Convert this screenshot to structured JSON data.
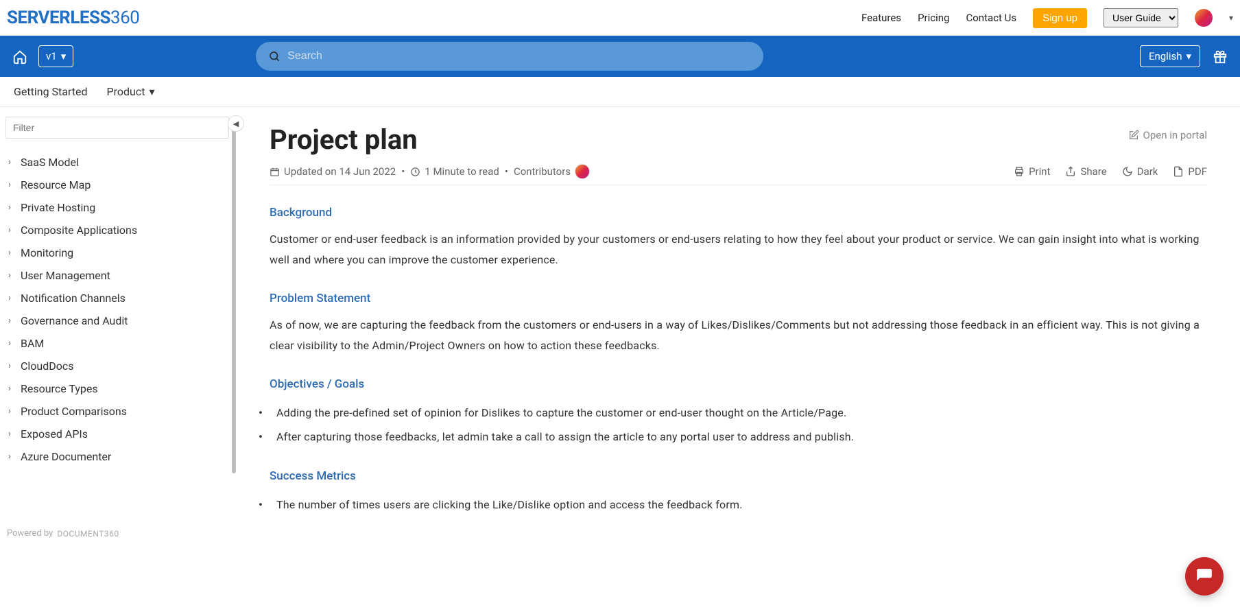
{
  "header": {
    "logo_prefix": "SERVERLESS",
    "logo_suffix": "360",
    "nav": {
      "features": "Features",
      "pricing": "Pricing",
      "contact": "Contact Us"
    },
    "signup": "Sign up",
    "user_guide": "User Guide"
  },
  "bluebar": {
    "version": "v1",
    "search_placeholder": "Search",
    "language": "English"
  },
  "subnav": {
    "getting_started": "Getting Started",
    "product": "Product"
  },
  "sidebar": {
    "filter_placeholder": "Filter",
    "items": [
      "SaaS Model",
      "Resource Map",
      "Private Hosting",
      "Composite Applications",
      "Monitoring",
      "User Management",
      "Notification Channels",
      "Governance and Audit",
      "BAM",
      "CloudDocs",
      "Resource Types",
      "Product Comparisons",
      "Exposed APIs",
      "Azure Documenter"
    ],
    "powered_by": "Powered by",
    "powered_brand": "DOCUMENT360"
  },
  "article": {
    "title": "Project plan",
    "open_in_portal": "Open in portal",
    "updated": "Updated on 14 Jun 2022",
    "read_time": "1 Minute to read",
    "contributors_label": "Contributors",
    "actions": {
      "print": "Print",
      "share": "Share",
      "dark": "Dark",
      "pdf": "PDF"
    },
    "sections": {
      "background_h": "Background",
      "background_p": "Customer or end-user feedback is an information provided by your customers or end-users relating to how they feel about your product or service. We can gain insight into what is working well and where you can improve the customer experience.",
      "problem_h": "Problem Statement",
      "problem_p": "As of now, we are capturing the feedback from the customers or end-users in a way of Likes/Dislikes/Comments but not addressing those feedback in an efficient way. This is not giving a clear visibility to the Admin/Project Owners on how to action these feedbacks.",
      "objectives_h": "Objectives / Goals",
      "objective_1": "Adding the pre-defined set of opinion for Dislikes to capture the customer or end-user thought on the Article/Page.",
      "objective_2": "After capturing those feedbacks, let admin take a call to assign the article to any portal user to address and publish.",
      "metrics_h": "Success Metrics",
      "metric_1": "The number of times users are clicking the Like/Dislike option and access the feedback form."
    }
  }
}
